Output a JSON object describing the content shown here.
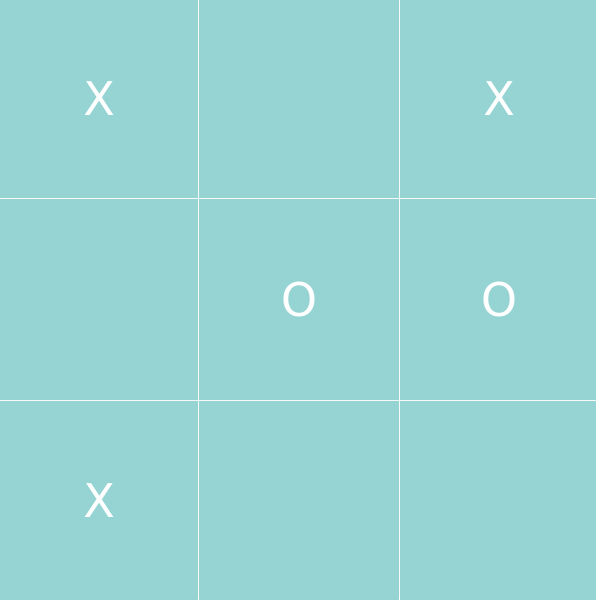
{
  "board": {
    "cells": [
      {
        "mark": "X"
      },
      {
        "mark": ""
      },
      {
        "mark": "X"
      },
      {
        "mark": ""
      },
      {
        "mark": "O"
      },
      {
        "mark": "O"
      },
      {
        "mark": "X"
      },
      {
        "mark": ""
      },
      {
        "mark": ""
      }
    ]
  },
  "colors": {
    "cell_background": "#96d3d3",
    "grid_lines": "#f4f9f9",
    "mark": "#ffffff"
  }
}
